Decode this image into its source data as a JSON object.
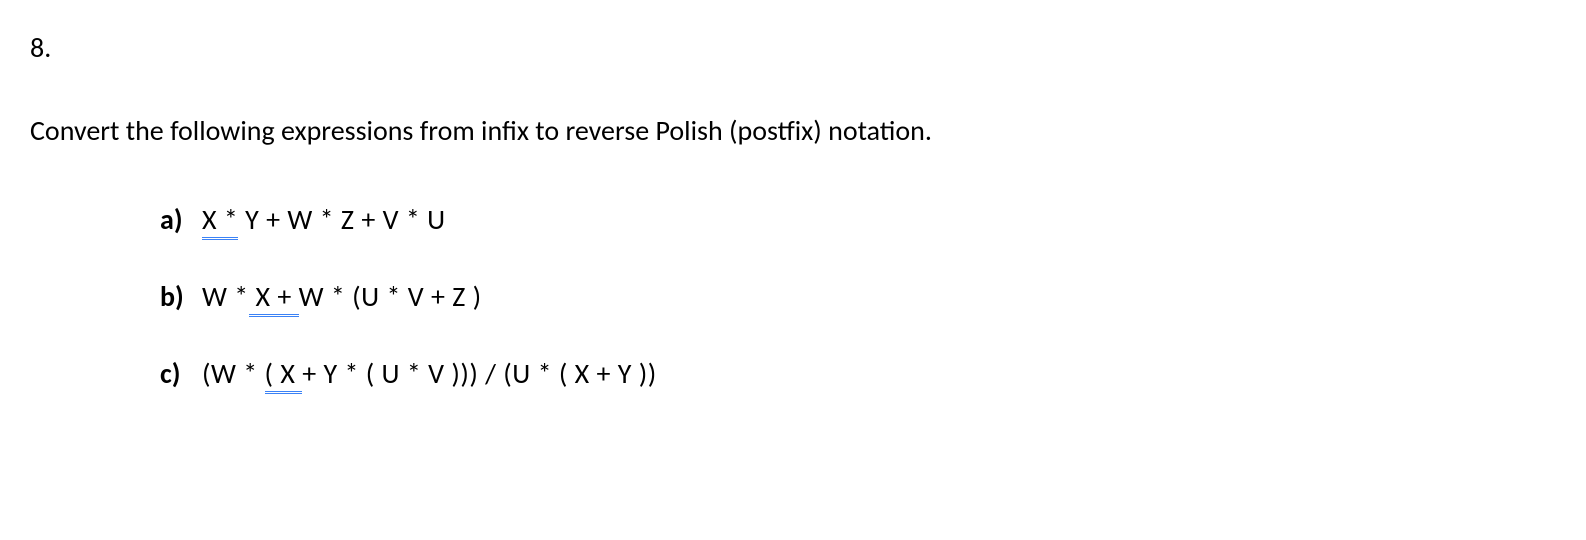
{
  "problem": {
    "number": "8.",
    "instruction": "Convert the following expressions from infix to reverse Polish (postfix) notation."
  },
  "items": [
    {
      "label": "a)",
      "underline_part": "X  *",
      "rest": " Y  +  W  *  Z  +  V  *  U"
    },
    {
      "label": "b)",
      "prefix": "W *",
      "underline_part": " X  + ",
      "rest": "W  * (U  *  V +  Z )"
    },
    {
      "label": "c)",
      "prefix": "(W * ",
      "underline_part": "( X ",
      "rest": "+ Y * ( U * V ))) / (U * ( X + Y ))"
    }
  ]
}
